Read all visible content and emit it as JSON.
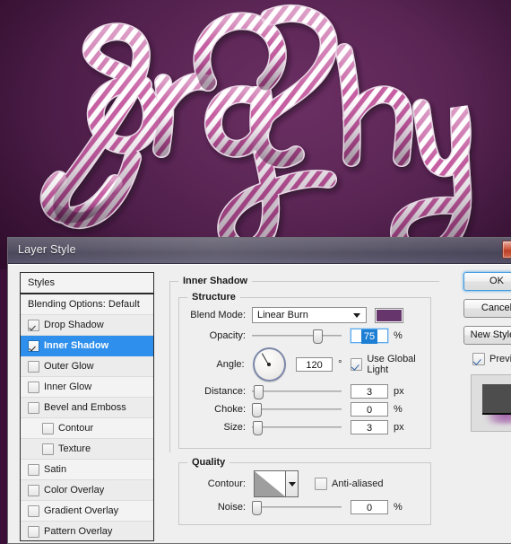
{
  "artwork": {
    "name": "candy-cane-rope-lettering",
    "word": "graphy",
    "background_top": "#5b2655",
    "background_bottom": "#3b1237",
    "stripe_color": "#c0559a",
    "rope_color": "#ffffff"
  },
  "dialog": {
    "title": "Layer Style",
    "close_label": ""
  },
  "styles_list": {
    "header": "Styles",
    "items": [
      {
        "label": "Blending Options: Default",
        "checkbox": false,
        "checked": false,
        "selected": false,
        "indent": false
      },
      {
        "label": "Drop Shadow",
        "checkbox": true,
        "checked": true,
        "selected": false,
        "indent": false
      },
      {
        "label": "Inner Shadow",
        "checkbox": true,
        "checked": true,
        "selected": true,
        "indent": false
      },
      {
        "label": "Outer Glow",
        "checkbox": true,
        "checked": false,
        "selected": false,
        "indent": false
      },
      {
        "label": "Inner Glow",
        "checkbox": true,
        "checked": false,
        "selected": false,
        "indent": false
      },
      {
        "label": "Bevel and Emboss",
        "checkbox": true,
        "checked": false,
        "selected": false,
        "indent": false
      },
      {
        "label": "Contour",
        "checkbox": true,
        "checked": false,
        "selected": false,
        "indent": true
      },
      {
        "label": "Texture",
        "checkbox": true,
        "checked": false,
        "selected": false,
        "indent": true
      },
      {
        "label": "Satin",
        "checkbox": true,
        "checked": false,
        "selected": false,
        "indent": false
      },
      {
        "label": "Color Overlay",
        "checkbox": true,
        "checked": false,
        "selected": false,
        "indent": false
      },
      {
        "label": "Gradient Overlay",
        "checkbox": true,
        "checked": false,
        "selected": false,
        "indent": false
      },
      {
        "label": "Pattern Overlay",
        "checkbox": true,
        "checked": false,
        "selected": false,
        "indent": false
      }
    ]
  },
  "panel": {
    "title": "Inner Shadow",
    "structure": {
      "legend": "Structure",
      "blend_mode_label": "Blend Mode:",
      "blend_mode_value": "Linear Burn",
      "shadow_color": "#66356b",
      "opacity_label": "Opacity:",
      "opacity_value": "75",
      "opacity_unit": "%",
      "angle_label": "Angle:",
      "angle_value": "120",
      "angle_unit": "°",
      "use_global_light": "Use Global Light",
      "use_global_light_checked": true,
      "distance_label": "Distance:",
      "distance_value": "3",
      "distance_unit": "px",
      "choke_label": "Choke:",
      "choke_value": "0",
      "choke_unit": "%",
      "size_label": "Size:",
      "size_value": "3",
      "size_unit": "px"
    },
    "quality": {
      "legend": "Quality",
      "contour_label": "Contour:",
      "anti_aliased_label": "Anti-aliased",
      "anti_aliased_checked": false,
      "noise_label": "Noise:",
      "noise_value": "0",
      "noise_unit": "%"
    }
  },
  "buttons": {
    "ok": "OK",
    "cancel": "Cancel",
    "new_style": "New Style...",
    "preview": "Preview",
    "preview_checked": true
  }
}
